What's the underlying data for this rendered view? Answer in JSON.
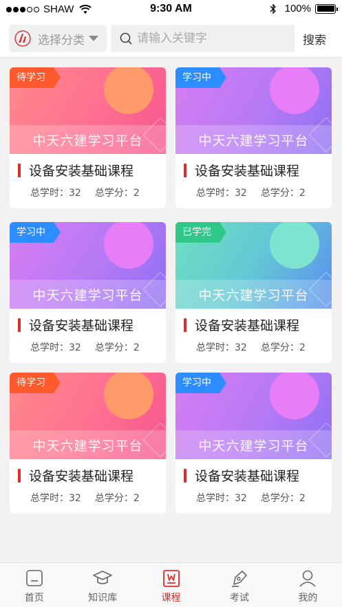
{
  "status_bar": {
    "carrier": "SHAW",
    "time": "9:30 AM",
    "battery": "100%"
  },
  "search_bar": {
    "category_label": "选择分类",
    "placeholder": "请输入关键字",
    "search_button": "搜索"
  },
  "courses": [
    {
      "tag": "待学习",
      "banner": "中天六建学习平台",
      "title": "设备安装基础课程",
      "hours_label": "总学时：",
      "hours": "32",
      "credits_label": "总学分：",
      "credits": "2"
    },
    {
      "tag": "学习中",
      "banner": "中天六建学习平台",
      "title": "设备安装基础课程",
      "hours_label": "总学时：",
      "hours": "32",
      "credits_label": "总学分：",
      "credits": "2"
    },
    {
      "tag": "学习中",
      "banner": "中天六建学习平台",
      "title": "设备安装基础课程",
      "hours_label": "总学时：",
      "hours": "32",
      "credits_label": "总学分：",
      "credits": "2"
    },
    {
      "tag": "已学完",
      "banner": "中天六建学习平台",
      "title": "设备安装基础课程",
      "hours_label": "总学时：",
      "hours": "32",
      "credits_label": "总学分：",
      "credits": "2"
    },
    {
      "tag": "待学习",
      "banner": "中天六建学习平台",
      "title": "设备安装基础课程",
      "hours_label": "总学时：",
      "hours": "32",
      "credits_label": "总学分：",
      "credits": "2"
    },
    {
      "tag": "学习中",
      "banner": "中天六建学习平台",
      "title": "设备安装基础课程",
      "hours_label": "总学时：",
      "hours": "32",
      "credits_label": "总学分：",
      "credits": "2"
    }
  ],
  "tabbar": [
    {
      "label": "首页",
      "icon": "home-icon"
    },
    {
      "label": "知识库",
      "icon": "graduation-cap-icon"
    },
    {
      "label": "课程",
      "icon": "course-book-icon",
      "active": true
    },
    {
      "label": "考试",
      "icon": "exam-pen-icon"
    },
    {
      "label": "我的",
      "icon": "profile-icon"
    }
  ],
  "colors": {
    "accent": "#e02b2b",
    "tag_todo": "#ff5a2e",
    "tag_learning": "#2d8cff",
    "tag_done": "#2fc88a"
  }
}
